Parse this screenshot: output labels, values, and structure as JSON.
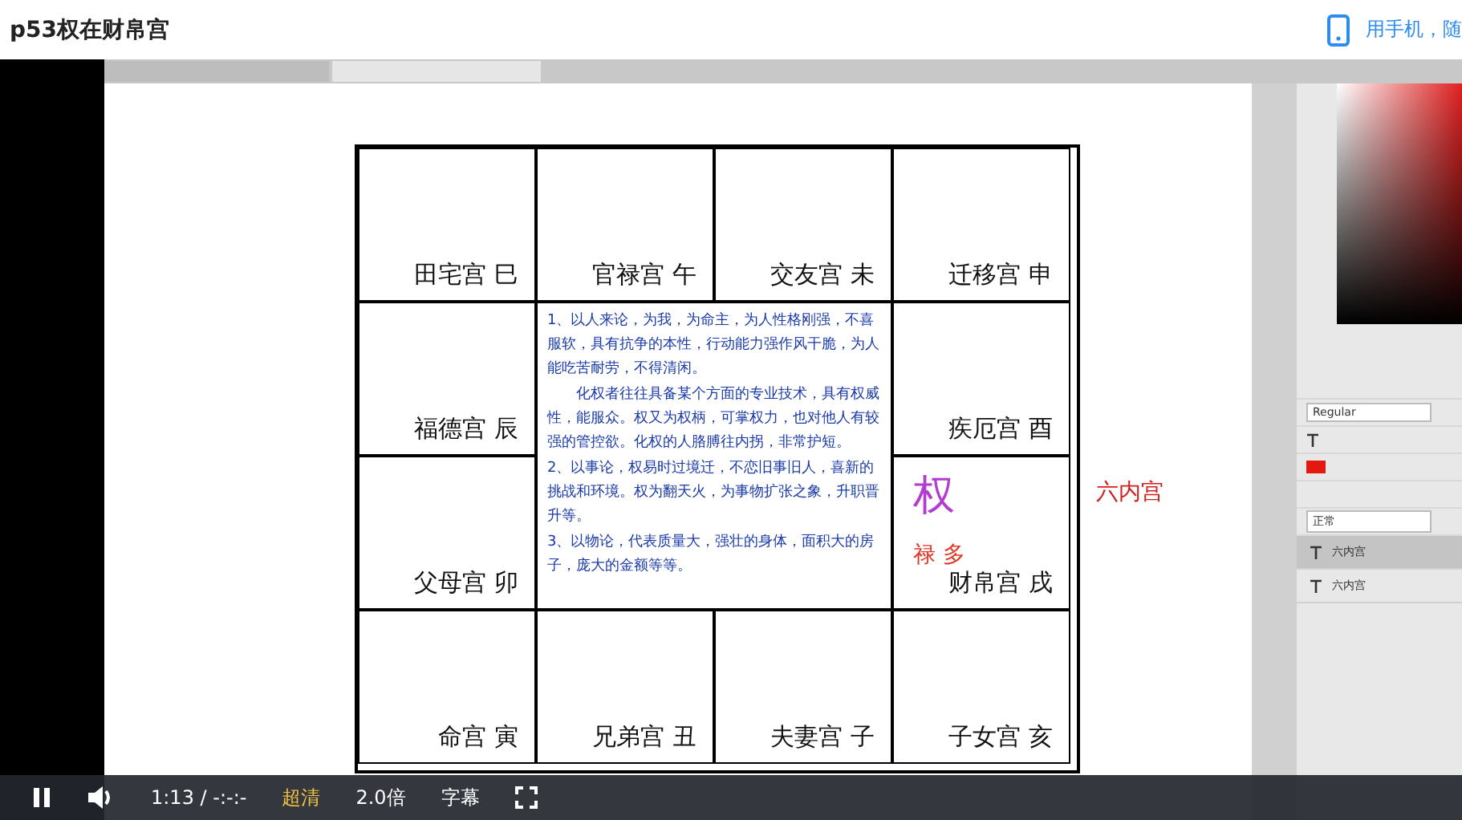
{
  "page": {
    "title": "p53权在财帛宫",
    "mobile_link": "用手机，随"
  },
  "chart": {
    "cells": [
      {
        "label": "田宅宫 巳"
      },
      {
        "label": "官禄宫 午"
      },
      {
        "label": "交友宫 未"
      },
      {
        "label": "迁移宫 申"
      },
      {
        "label": "福德宫 辰"
      },
      {
        "label": "疾厄宫 酉"
      },
      {
        "label": "父母宫 卯"
      },
      {
        "label": "财帛宫 戌",
        "star": "权",
        "note": "禄 多"
      },
      {
        "label": "命宫 寅"
      },
      {
        "label": "兄弟宫 丑"
      },
      {
        "label": "夫妻宫 子"
      },
      {
        "label": "子女宫 亥"
      }
    ],
    "center_paragraphs": [
      "1、以人来论，为我，为命主，为人性格刚强，不喜服软，具有抗争的本性，行动能力强作风干脆，为人能吃苦耐劳，不得清闲。",
      "化权者往往具备某个方面的专业技术，具有权威性，能服众。权又为权柄，可掌权力，也对他人有较强的管控欲。化权的人胳膊往内拐，非常护短。",
      "2、以事论，权易时过境迁，不恋旧事旧人，喜新的挑战和环境。权为翻天火，为事物扩张之象，升职晋升等。",
      "3、以物论，代表质量大，强壮的身体，面积大的房子，庞大的金额等等。"
    ],
    "side_label": "六内宫"
  },
  "editor_panel": {
    "font_style": "Regular",
    "blend_mode": "正常",
    "layers": [
      {
        "name": "六内宫",
        "selected": true
      },
      {
        "name": "六内宫",
        "selected": false
      }
    ]
  },
  "player": {
    "playing": true,
    "time": "1:13 / -:-:-",
    "quality": "超清",
    "speed": "2.0倍",
    "subtitles": "字幕"
  }
}
